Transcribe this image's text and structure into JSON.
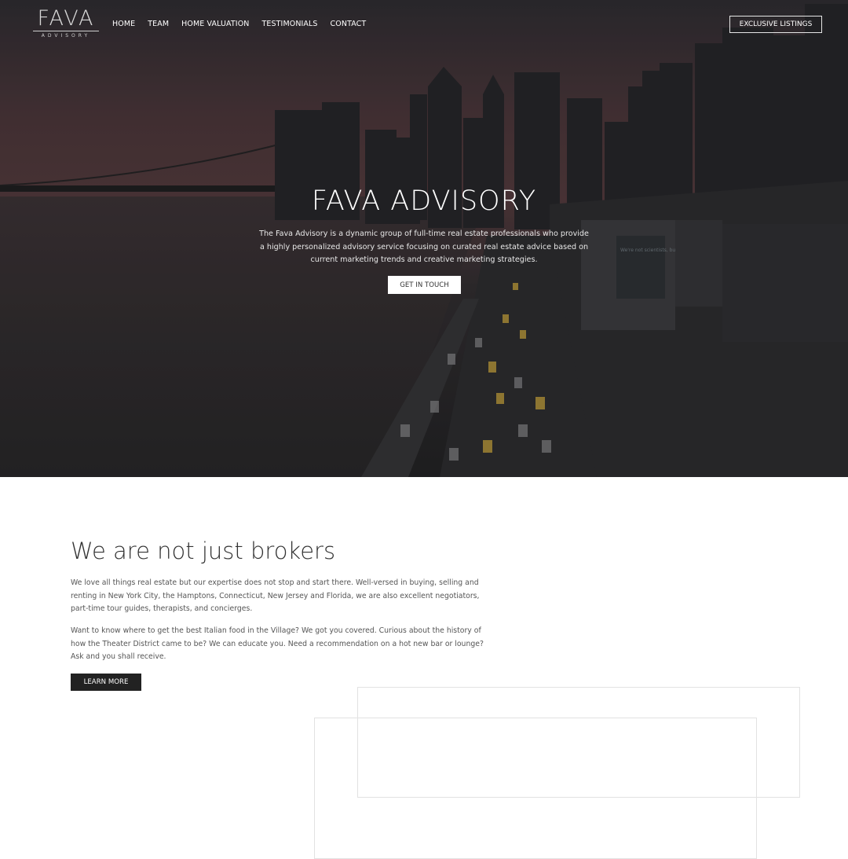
{
  "header": {
    "logo": {
      "wordmark": "FAVA",
      "subline": "ADVISORY"
    },
    "nav": [
      {
        "label": "HOME"
      },
      {
        "label": "TEAM"
      },
      {
        "label": "HOME VALUATION"
      },
      {
        "label": "TESTIMONIALS"
      },
      {
        "label": "CONTACT"
      }
    ],
    "exclusive_label": "EXCLUSIVE LISTINGS"
  },
  "hero": {
    "title": "FAVA ADVISORY",
    "description": "The Fava Advisory is a dynamic group of full-time real estate professionals who provide a highly personalized advisory service focusing on curated real estate advice based on current marketing trends and creative marketing strategies.",
    "cta_label": "GET IN TOUCH",
    "billboard_text": "We're not scientists, but we totally get space."
  },
  "about": {
    "title": "We are not just brokers",
    "paragraph1": "We love all things real estate but our expertise does not stop and start there. Well-versed in buying, selling and renting in New York City, the Hamptons, Connecticut, New Jersey and Florida, we are also excellent negotiators, part-time tour guides, therapists, and concierges.",
    "paragraph2": "Want to know where to get the best Italian food in the Village? We got you covered. Curious about the history of how the Theater District came to be? We can educate you. Need a recommendation on a hot new bar or lounge? Ask and you shall receive.",
    "learn_more_label": "LEARN MORE"
  },
  "colors": {
    "dark_button": "#222222",
    "text_dark": "#333333",
    "text_body": "#555555",
    "frame_line": "#e2e2e2"
  }
}
